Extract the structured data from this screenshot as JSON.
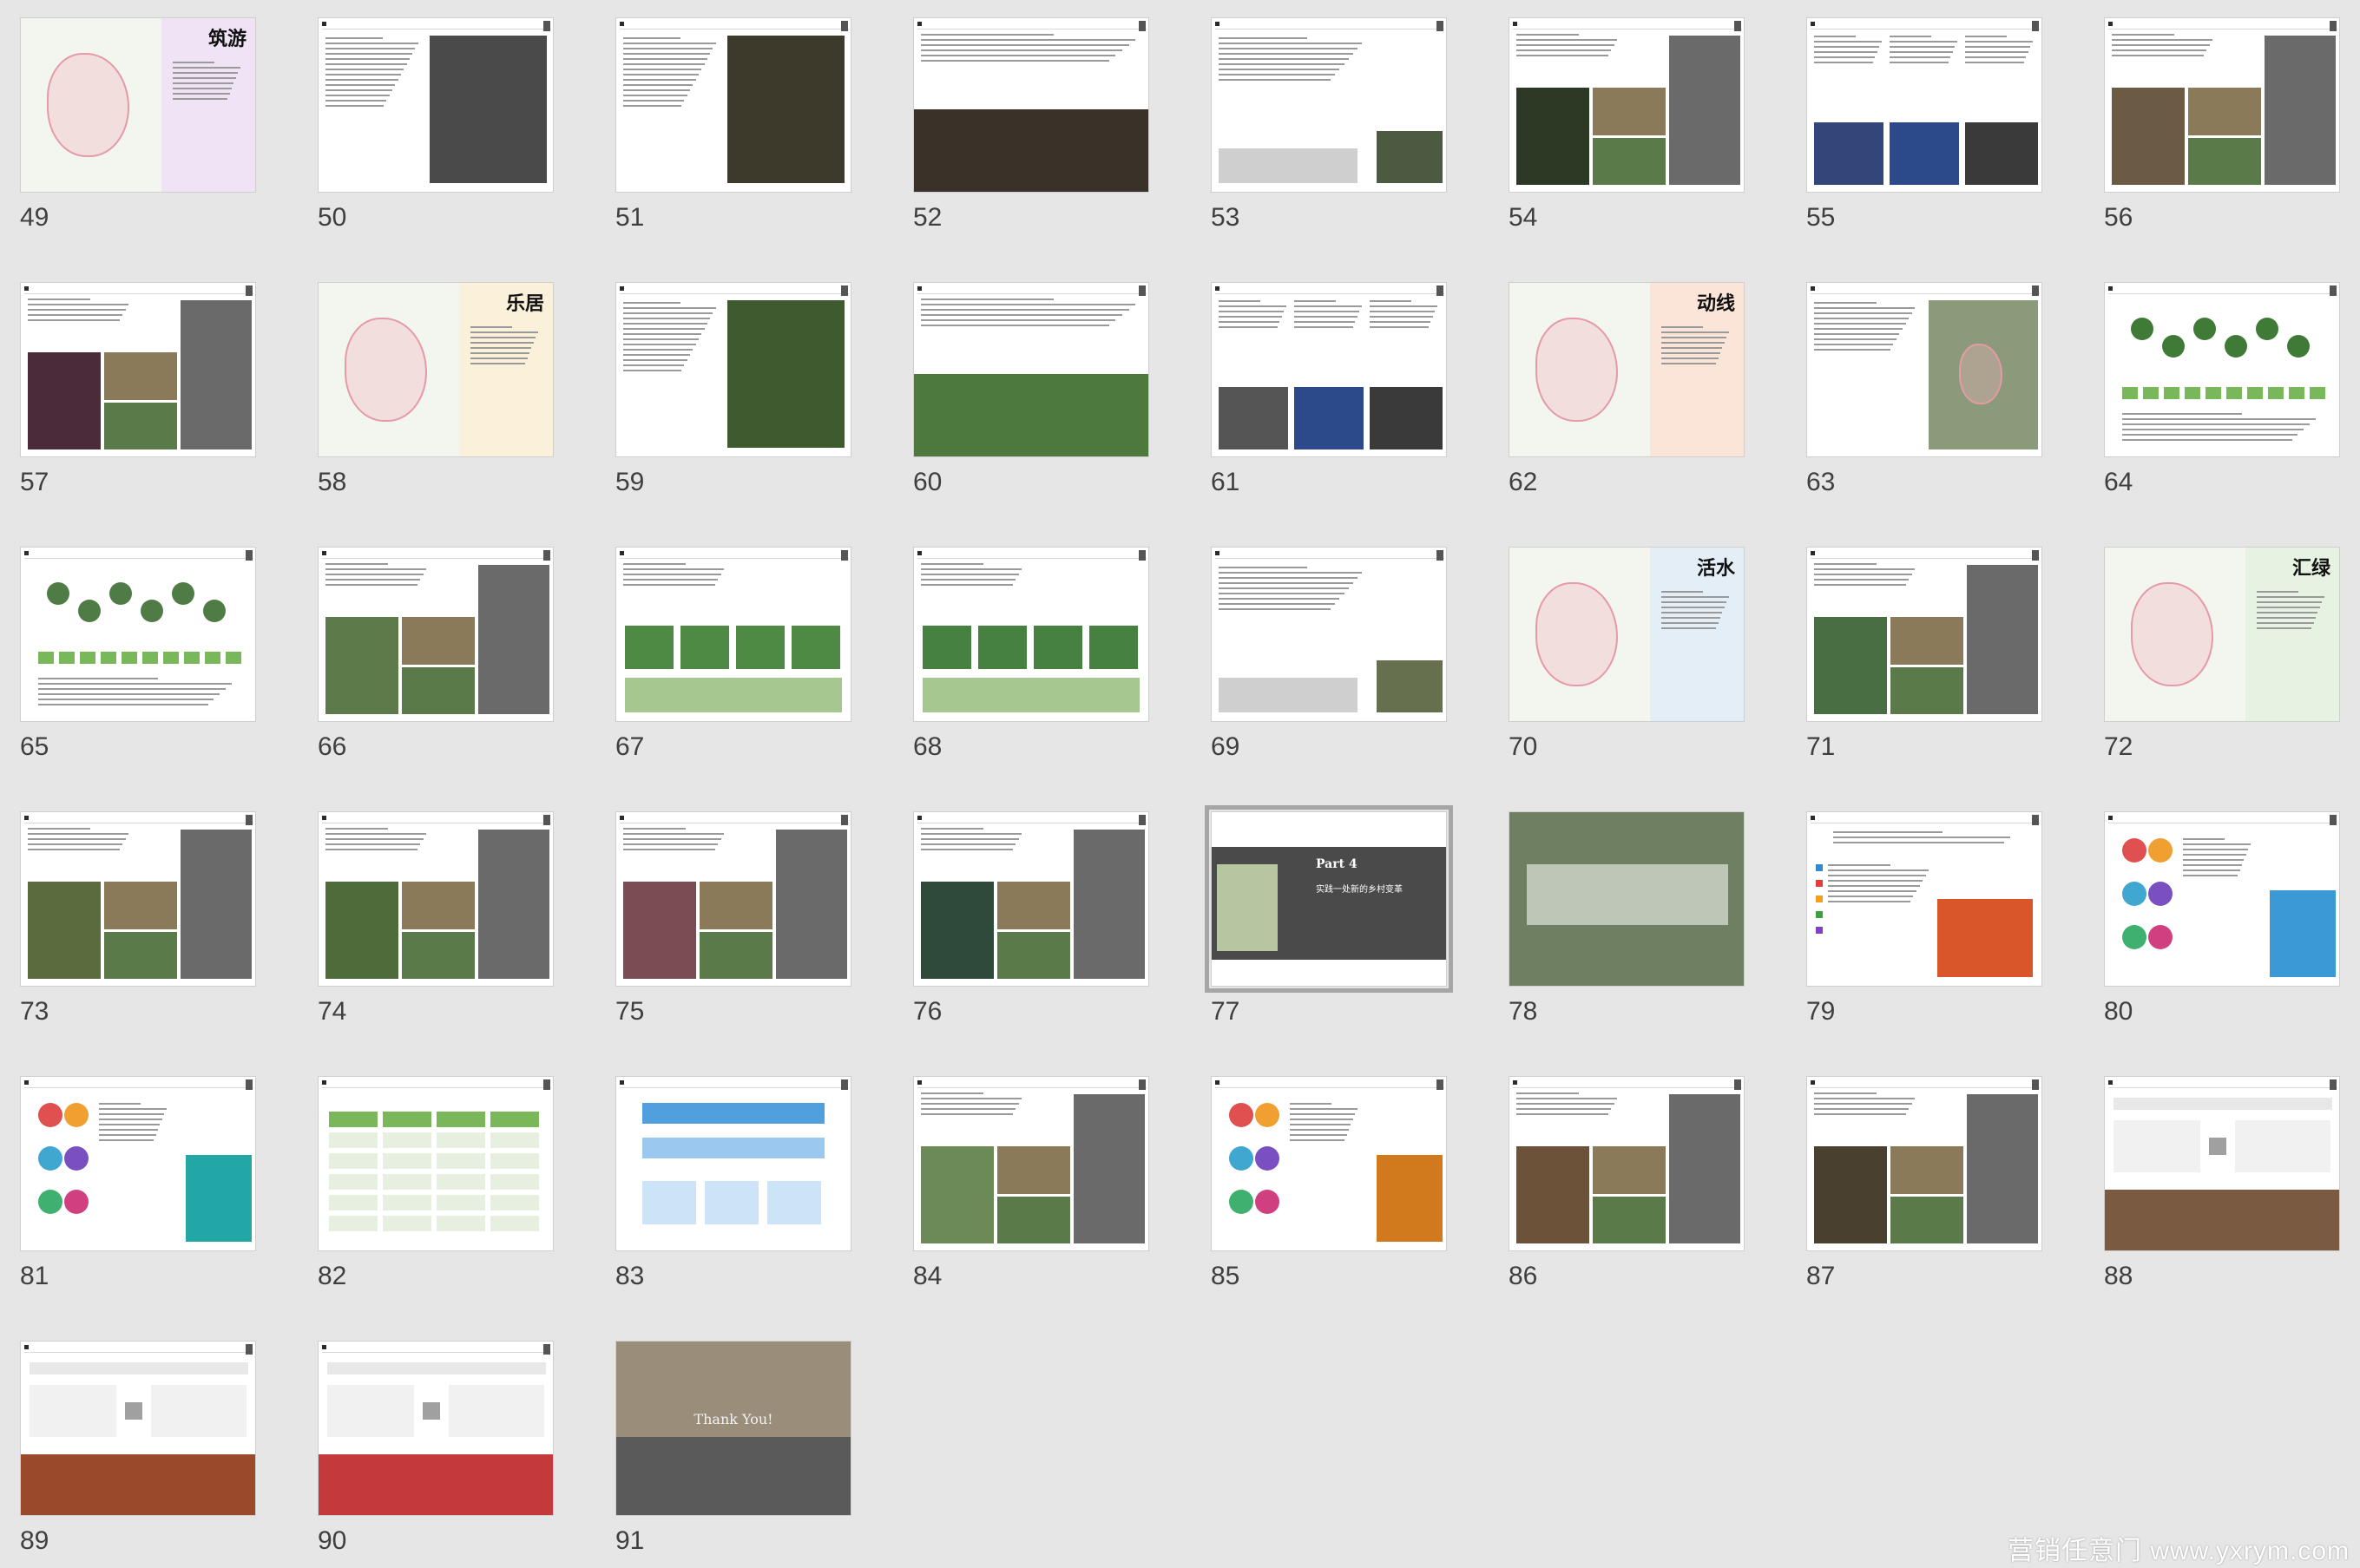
{
  "view": "slide-sorter",
  "watermark": "营销任意门 www.yxrym.com",
  "selected_slide": 77,
  "slides": [
    {
      "num": "49",
      "title": "筑游",
      "theme": "mapTitle",
      "band": "#f0e3f5"
    },
    {
      "num": "50",
      "theme": "textImage",
      "img": "#4a4a4a"
    },
    {
      "num": "51",
      "theme": "textImage",
      "img": "#3d3a2c"
    },
    {
      "num": "52",
      "theme": "topImage",
      "img": "#3a3128"
    },
    {
      "num": "53",
      "theme": "textImageSmall",
      "img": "#4c5a41"
    },
    {
      "num": "54",
      "theme": "collage",
      "img": "#2c3a25"
    },
    {
      "num": "55",
      "theme": "threeCol",
      "img": "#33467a"
    },
    {
      "num": "56",
      "theme": "collage",
      "img": "#6b5a44"
    },
    {
      "num": "57",
      "theme": "collage",
      "img": "#4b2a3a"
    },
    {
      "num": "58",
      "title": "乐居",
      "theme": "mapTitle",
      "band": "#fbf0d9"
    },
    {
      "num": "59",
      "theme": "textImage",
      "img": "#3f5a2e"
    },
    {
      "num": "60",
      "theme": "topImage",
      "img": "#4d7a3c"
    },
    {
      "num": "61",
      "theme": "threeCol",
      "img": "#555555"
    },
    {
      "num": "62",
      "title": "动线",
      "theme": "mapTitle",
      "band": "#fbe5d9"
    },
    {
      "num": "63",
      "theme": "map",
      "img": "#8a9a7a"
    },
    {
      "num": "64",
      "theme": "diagramGreen",
      "img": "#3f7a36"
    },
    {
      "num": "65",
      "theme": "diagramGreen",
      "img": "#4e7b46"
    },
    {
      "num": "66",
      "theme": "collage",
      "img": "#5d7a4a"
    },
    {
      "num": "67",
      "theme": "sections",
      "img": "#4f8a45"
    },
    {
      "num": "68",
      "theme": "sections",
      "img": "#468140"
    },
    {
      "num": "69",
      "theme": "textImageSmall",
      "img": "#66704e"
    },
    {
      "num": "70",
      "title": "活水",
      "theme": "mapTitle",
      "band": "#e3eef6"
    },
    {
      "num": "71",
      "theme": "collage",
      "img": "#4a6e44"
    },
    {
      "num": "72",
      "title": "汇绿",
      "theme": "mapTitle",
      "band": "#e6f3e2"
    },
    {
      "num": "73",
      "theme": "collage",
      "img": "#5a6b3e"
    },
    {
      "num": "74",
      "theme": "collage",
      "img": "#4f6b3a"
    },
    {
      "num": "75",
      "theme": "collage",
      "img": "#7a4d55"
    },
    {
      "num": "76",
      "theme": "collage",
      "img": "#2f4a3a"
    },
    {
      "num": "77",
      "theme": "part4",
      "img": "#777777",
      "part": "Part 4",
      "subtitle": "实践一处新的乡村变革"
    },
    {
      "num": "78",
      "theme": "banner",
      "img": "#6f8062"
    },
    {
      "num": "79",
      "theme": "colorList",
      "img": "#2e8bd0"
    },
    {
      "num": "80",
      "theme": "circles",
      "img": "#3b9ad6"
    },
    {
      "num": "81",
      "theme": "circles",
      "img": "#22a6a6"
    },
    {
      "num": "82",
      "theme": "table",
      "img": "#7ab65a"
    },
    {
      "num": "83",
      "theme": "blueFlow",
      "img": "#4fa0dc"
    },
    {
      "num": "84",
      "theme": "collage",
      "img": "#6c8a58"
    },
    {
      "num": "85",
      "theme": "circles",
      "img": "#d07a1d"
    },
    {
      "num": "86",
      "theme": "collage",
      "img": "#6b5238"
    },
    {
      "num": "87",
      "theme": "collage",
      "img": "#4a4030"
    },
    {
      "num": "88",
      "theme": "flowPhoto",
      "img": "#7a5a40"
    },
    {
      "num": "89",
      "theme": "flowPhoto",
      "img": "#9a4a2a"
    },
    {
      "num": "90",
      "theme": "flowPhoto",
      "img": "#c43a3a"
    },
    {
      "num": "91",
      "theme": "thanks",
      "img": "#9a8d7a",
      "text": "Thank You!"
    }
  ]
}
